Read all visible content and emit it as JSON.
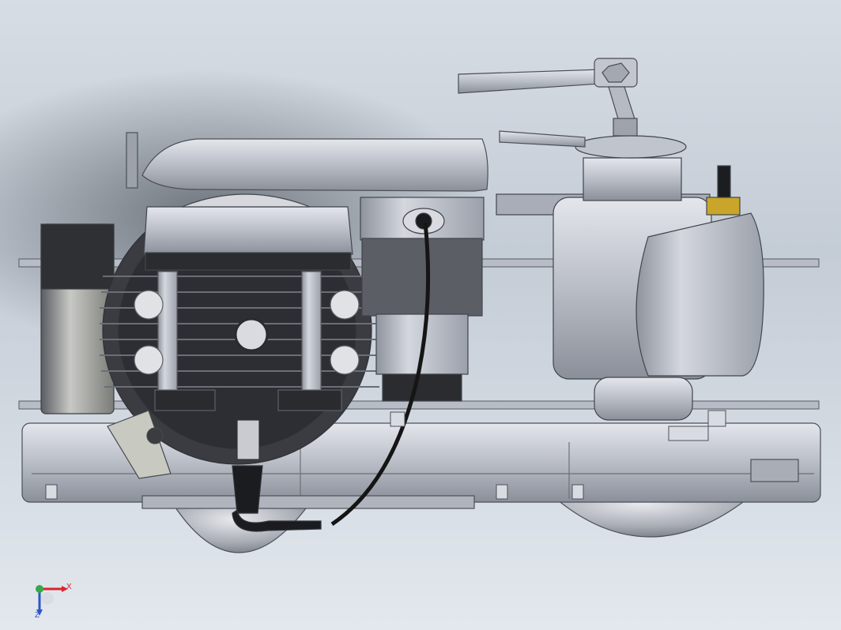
{
  "viewport": {
    "background_colors": [
      "#2a2f36",
      "#c4ccd6",
      "#e3e8ee"
    ],
    "model_colors": {
      "metal_light": "#c9ccd4",
      "metal_mid": "#9ea3ad",
      "metal_dark": "#5c616b",
      "black_part": "#2b2c30",
      "brass": "#c9a52a",
      "cable": "#151515"
    }
  },
  "triad": {
    "x_label": "X",
    "y_label": "",
    "z_label": "Z",
    "x_color": "#d8262c",
    "y_color": "#35a84a",
    "z_color": "#2d55c8"
  }
}
